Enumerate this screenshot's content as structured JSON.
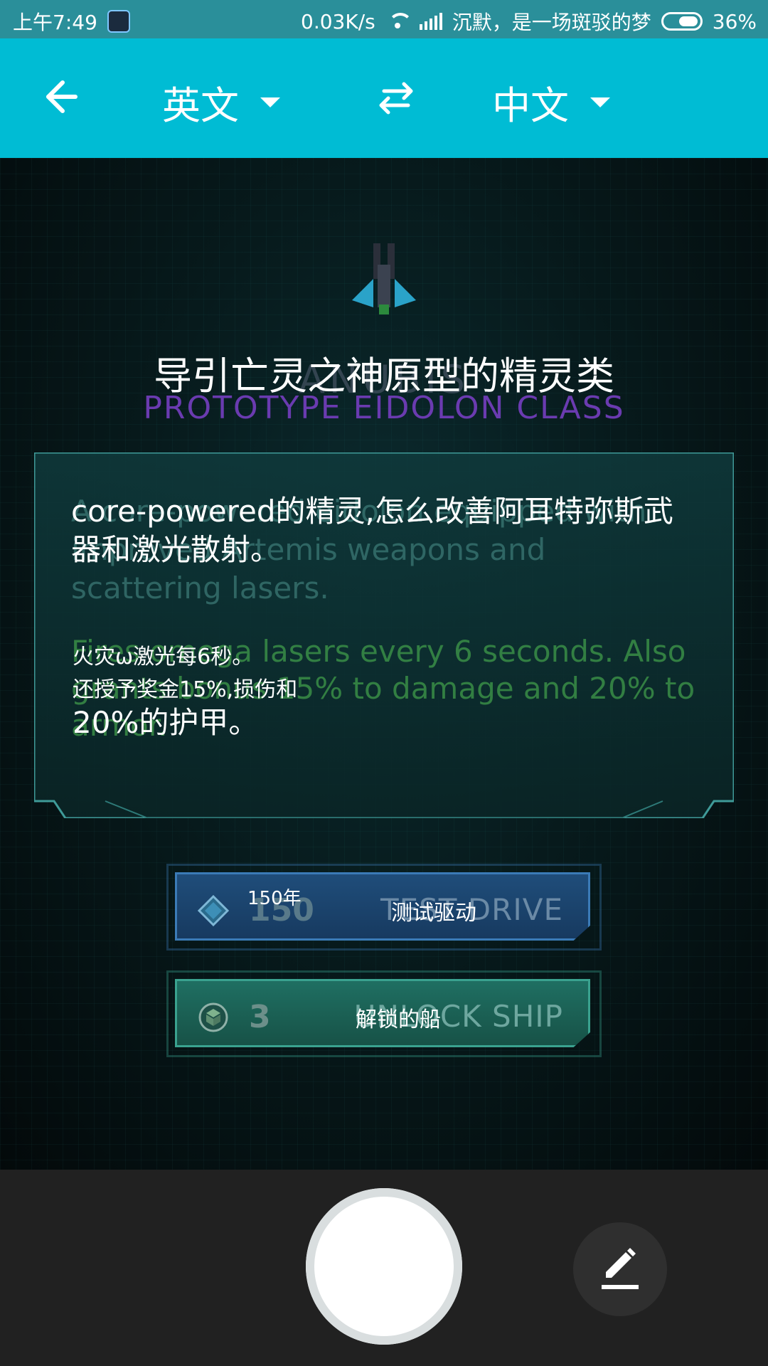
{
  "status_bar": {
    "time": "上午7:49",
    "speed": "0.03K/s",
    "carrier": "沉默，是一场斑驳的梦",
    "battery": "36%",
    "icons": [
      "app-icon",
      "wifi-icon",
      "signal-icon",
      "battery-icon"
    ]
  },
  "toolbar": {
    "source_lang": "英文",
    "target_lang": "中文",
    "icons": [
      "back-arrow-icon",
      "dropdown-caret-icon",
      "swap-icon"
    ]
  },
  "game": {
    "title_cn": "导引亡灵之神原型的精灵类",
    "title_en": "ANUBIS",
    "subtitle": "PROTOTYPE EIDOLON CLASS",
    "description_en": "A core-powered eidolon equipped with improved Artemis weapons and scattering lasers.",
    "description_cn": "core-powered的精灵,怎么改善阿耳特弥斯武器和激光散射。",
    "effect_en": "Fires omega lasers every 6 seconds. Also grants bonus 15% to damage and 20% to armor.",
    "effect_cn_1": "火灾ω激光每6秒。",
    "effect_cn_2": "还授予奖金15%,损伤和",
    "effect_cn_3": "20%的护甲。",
    "buttons": [
      {
        "num_en": "150",
        "num_cn": "150年",
        "label_en": "TEST DRIVE",
        "label_cn": "测试驱动",
        "icon": "diamond-icon"
      },
      {
        "num_en": "3",
        "num_cn": "3",
        "label_en": "UNLOCK SHIP",
        "label_cn": "解锁的船",
        "icon": "cube-icon"
      }
    ]
  },
  "bottom_bar": {
    "icons": [
      "shutter-button",
      "edit-pencil-icon"
    ]
  },
  "colors": {
    "toolbar": "#00bcd4",
    "status_bar": "#2a8f9a",
    "subtitle": "#6a3bb0",
    "effect_green": "#3f9b4a",
    "bottom_bar": "#212121"
  }
}
